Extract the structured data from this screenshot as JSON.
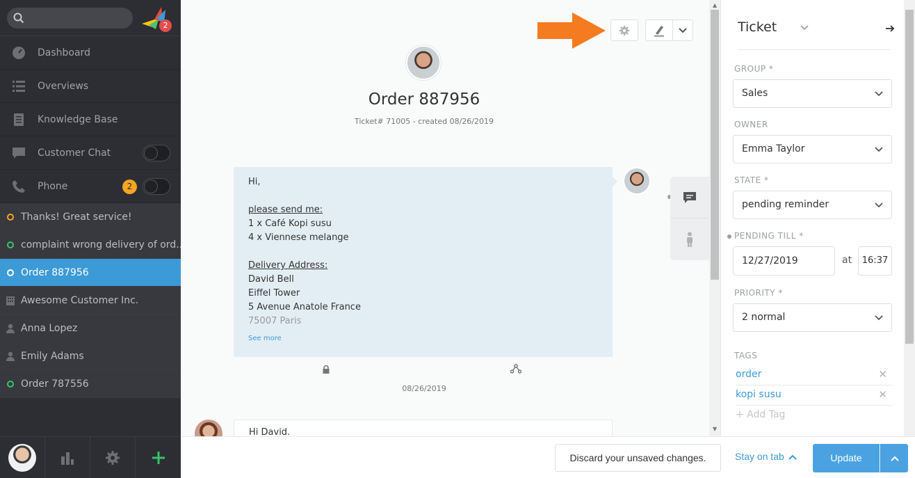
{
  "sidebar": {
    "logo_badge": "2",
    "nav": [
      {
        "label": "Dashboard",
        "icon": "dashboard-icon"
      },
      {
        "label": "Overviews",
        "icon": "list-icon"
      },
      {
        "label": "Knowledge Base",
        "icon": "book-icon"
      },
      {
        "label": "Customer Chat",
        "icon": "chat-icon"
      },
      {
        "label": "Phone",
        "icon": "phone-icon",
        "badge": "2"
      }
    ],
    "tasks": [
      {
        "label": "Thanks! Great service!",
        "icon": "ring-yellow"
      },
      {
        "label": "complaint wrong delivery of ord...",
        "icon": "ring-green"
      },
      {
        "label": "Order 887956",
        "icon": "ring-white",
        "active": true
      },
      {
        "label": "Awesome Customer Inc.",
        "icon": "building-icon"
      },
      {
        "label": "Anna Lopez",
        "icon": "person-icon"
      },
      {
        "label": "Emily Adams",
        "icon": "person-icon"
      },
      {
        "label": "Order 787556",
        "icon": "ring-green"
      }
    ]
  },
  "ticket": {
    "title": "Order 887956",
    "meta": "Ticket# 71005 - created 08/26/2019",
    "article": {
      "greeting": "Hi,",
      "send_heading": "please send me:",
      "items": [
        "1 x Café Kopi susu",
        "4 x Viennese melange"
      ],
      "address_heading": "Delivery Address:",
      "address": [
        "David Bell",
        "Eiffel Tower",
        "5 Avenue Anatole France"
      ],
      "address_faded": "75007 Paris",
      "see_more": "See more",
      "date": "08/26/2019"
    },
    "article2": {
      "text": "Hi David."
    }
  },
  "panel": {
    "title": "Ticket",
    "group_label": "GROUP *",
    "group_value": "Sales",
    "owner_label": "OWNER",
    "owner_value": "Emma Taylor",
    "state_label": "STATE *",
    "state_value": "pending reminder",
    "pending_label": "PENDING TILL *",
    "pending_date": "12/27/2019",
    "at_label": "at",
    "pending_time": "16:37",
    "priority_label": "PRIORITY *",
    "priority_value": "2 normal",
    "tags_label": "TAGS",
    "tags": [
      "order",
      "kopi susu"
    ],
    "add_tag": "+ Add Tag"
  },
  "bottom": {
    "discard": "Discard your unsaved changes.",
    "stay_on_tab": "Stay on tab",
    "update": "Update"
  },
  "colors": {
    "sidebar_bg": "#2c2e33",
    "active_task": "#3c9ad6",
    "accent_blue": "#4aa3e0",
    "annotation_arrow": "#f47b20",
    "badge_orange": "#f5a623"
  }
}
